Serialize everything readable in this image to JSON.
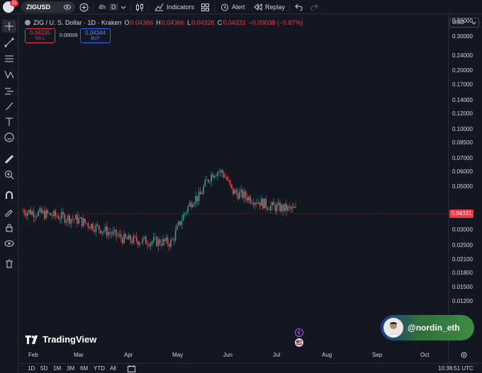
{
  "topbar": {
    "notification_count": "11",
    "symbol": "ZIGUSD",
    "timeframe": "4h",
    "timeframe_selected": "D",
    "indicators_label": "Indicators",
    "alert_label": "Alert",
    "replay_label": "Replay"
  },
  "legend": {
    "title": "ZIG / U. S. Dollar · 1D · Kraken",
    "o_label": "O",
    "o_val": "0.04366",
    "h_label": "H",
    "h_val": "0.04366",
    "l_label": "L",
    "l_val": "0.04326",
    "c_label": "C",
    "c_val": "0.04331",
    "change": "−0.00038 (−0.87%)"
  },
  "trade": {
    "sell_price": "0.04335",
    "sell_label": "SELL",
    "spread": "0.00009",
    "buy_price": "0.04344",
    "buy_label": "BUY"
  },
  "axis": {
    "currency": "USD",
    "last_price": "0.04331",
    "y_labels": [
      "0.36000",
      "0.30000",
      "0.24000",
      "0.20000",
      "0.17000",
      "0.14000",
      "0.12000",
      "0.10000",
      "0.08500",
      "0.07000",
      "0.06000",
      "0.05000",
      "0.03600",
      "0.03000",
      "0.02500",
      "0.02100",
      "0.01800",
      "0.01500",
      "0.01200",
      "0.00920"
    ],
    "x_labels": [
      "Feb",
      "Mar",
      "Apr",
      "May",
      "Jun",
      "Jul",
      "Aug",
      "Sep",
      "Oct"
    ]
  },
  "ranges": [
    "1D",
    "5D",
    "1M",
    "3M",
    "6M",
    "YTD",
    "All"
  ],
  "clock": "10:38:51 UTC",
  "branding": {
    "tradingview": "TradingView",
    "watermark_handle": "@nordin_eth"
  },
  "colors": {
    "up": "#26a69a",
    "down": "#ef5350",
    "background": "#131722",
    "accent": "#2962ff"
  },
  "chart_data": {
    "type": "candlestick",
    "title": "ZIG / U. S. Dollar · 1D · Kraken",
    "y_scale": "log",
    "ylim": [
      0.0092,
      0.38
    ],
    "x_range": [
      "Feb",
      "Oct"
    ],
    "last_close": 0.04331,
    "approx_close_path": [
      {
        "x": "Feb",
        "y": 0.043
      },
      {
        "x": "Mar",
        "y": 0.039
      },
      {
        "x": "Apr",
        "y": 0.031
      },
      {
        "x": "May",
        "y": 0.03
      },
      {
        "x": "May (late)",
        "y": 0.049
      },
      {
        "x": "Jun",
        "y": 0.055
      },
      {
        "x": "Jul",
        "y": 0.045
      },
      {
        "x": "Jul (mid)",
        "y": 0.04331
      }
    ]
  }
}
